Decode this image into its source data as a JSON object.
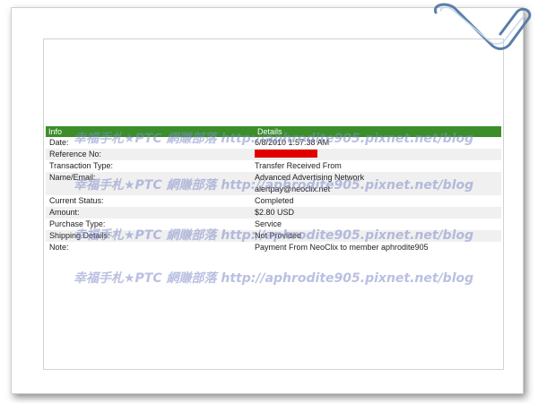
{
  "table": {
    "header": {
      "col1": "Info",
      "col2": "Details"
    },
    "rows": [
      {
        "label": "Date:",
        "value": "6/8/2010 1:57:38 AM"
      },
      {
        "label": "Reference No:",
        "value": ""
      },
      {
        "label": "Transaction Type:",
        "value": "Transfer Received From"
      },
      {
        "label": "Name/Email:",
        "value": "Advanced Advertising Network",
        "value2": "alertpay@neoclix.net"
      },
      {
        "label": "Current Status:",
        "value": "Completed"
      },
      {
        "label": "Amount:",
        "value": "$2.80 USD"
      },
      {
        "label": "Purchase Type:",
        "value": "Service"
      },
      {
        "label": "Shipping Details:",
        "value": "Not Provided"
      },
      {
        "label": "Note:",
        "value": "Payment From NeoClix to member aphrodite905"
      }
    ]
  },
  "watermark": "幸福手札★PTC 網賺部落 http://aphrodite905.pixnet.net/blog",
  "colors": {
    "header_bg": "#3b8e2a",
    "redaction": "#e00000",
    "watermark": "#8c8cc8"
  }
}
